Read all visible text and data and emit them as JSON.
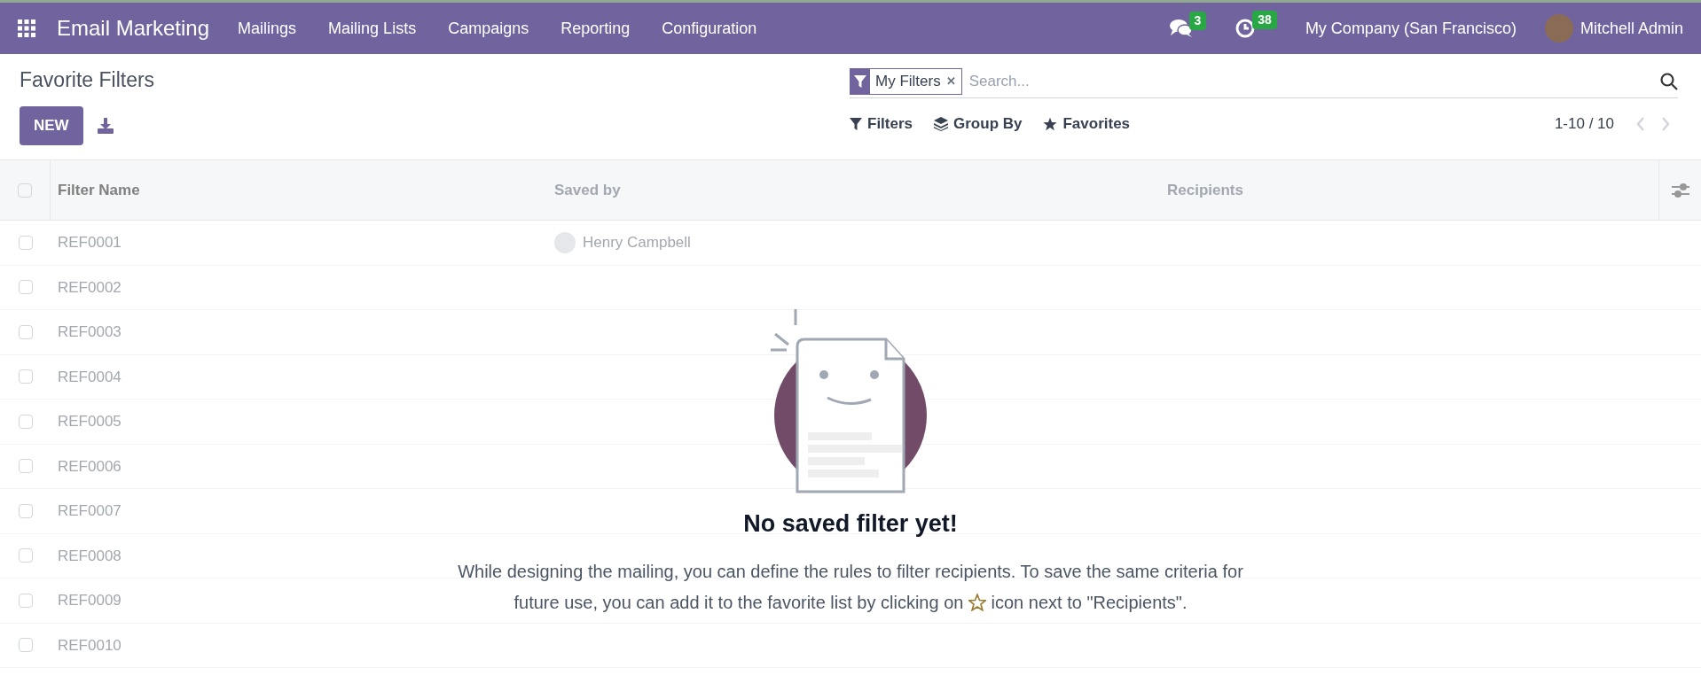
{
  "navbar": {
    "app_name": "Email Marketing",
    "menu": [
      "Mailings",
      "Mailing Lists",
      "Campaigns",
      "Reporting",
      "Configuration"
    ],
    "messages_count": "3",
    "activities_count": "38",
    "company": "My Company (San Francisco)",
    "user": "Mitchell Admin"
  },
  "page": {
    "title": "Favorite Filters",
    "new_button": "NEW"
  },
  "search": {
    "facet": "My Filters",
    "facet_remove": "✕",
    "placeholder": "Search..."
  },
  "toolbar": {
    "filters": "Filters",
    "group_by": "Group By",
    "favorites": "Favorites",
    "pager": "1-10 / 10"
  },
  "table": {
    "columns": [
      "Filter Name",
      "Saved by",
      "Recipients"
    ],
    "select_all_checked": false,
    "rows": [
      {
        "name": "REF0001",
        "saved_by": "Henry Campbell",
        "checked": false
      },
      {
        "name": "REF0002",
        "checked": false
      },
      {
        "name": "REF0003",
        "checked": false
      },
      {
        "name": "REF0004",
        "checked": false
      },
      {
        "name": "REF0005",
        "checked": false
      },
      {
        "name": "REF0006",
        "checked": false
      },
      {
        "name": "REF0007",
        "checked": false
      },
      {
        "name": "REF0008",
        "checked": false
      },
      {
        "name": "REF0009",
        "checked": false
      },
      {
        "name": "REF0010",
        "checked": false
      }
    ]
  },
  "empty_state": {
    "title": "No saved filter yet!",
    "text_before_icon": "While designing the mailing, you can define the rules to filter recipients. To save the same criteria for future use, you can add it to the favorite list by clicking on",
    "text_after_icon": "icon next to \"Recipients\"."
  }
}
